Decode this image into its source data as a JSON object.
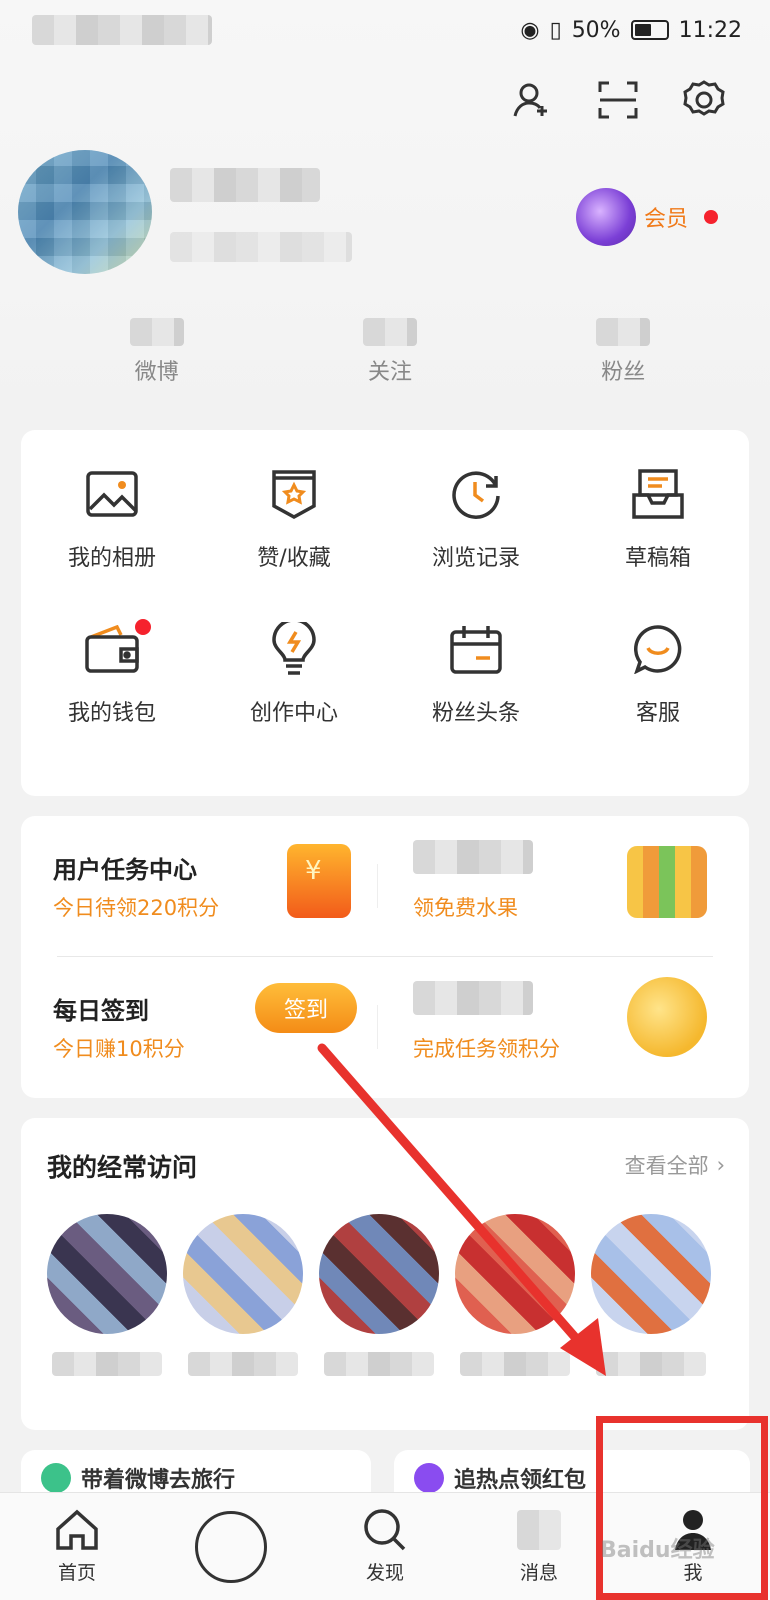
{
  "status_bar": {
    "battery": "50%",
    "time": "11:22"
  },
  "header": {
    "icons": [
      "add-friend-icon",
      "scan-icon",
      "settings-icon"
    ]
  },
  "profile": {
    "vip_label": "会员"
  },
  "stats": [
    {
      "label": "微博"
    },
    {
      "label": "关注"
    },
    {
      "label": "粉丝"
    }
  ],
  "grid": [
    {
      "label": "我的相册",
      "icon": "photo-album-icon"
    },
    {
      "label": "赞/收藏",
      "icon": "favorite-icon"
    },
    {
      "label": "浏览记录",
      "icon": "history-icon"
    },
    {
      "label": "草稿箱",
      "icon": "draft-box-icon"
    },
    {
      "label": "我的钱包",
      "icon": "wallet-icon"
    },
    {
      "label": "创作中心",
      "icon": "creator-center-icon"
    },
    {
      "label": "粉丝头条",
      "icon": "fans-headline-icon"
    },
    {
      "label": "客服",
      "icon": "customer-service-icon"
    }
  ],
  "tasks": {
    "task_center_title": "用户任务中心",
    "task_center_sub": "今日待领220积分",
    "fruit_sub": "领免费水果",
    "checkin_title": "每日签到",
    "checkin_sub": "今日赚10积分",
    "checkin_button": "签到",
    "points_sub": "完成任务领积分"
  },
  "frequent": {
    "title": "我的经常访问",
    "view_all": "查看全部"
  },
  "peek_cards": {
    "left": "带着微博去旅行",
    "right": "追热点领红包"
  },
  "bottom_nav": [
    {
      "label": "首页",
      "icon": "home-icon"
    },
    {
      "label": "",
      "icon": "publish-icon"
    },
    {
      "label": "发现",
      "icon": "discover-icon"
    },
    {
      "label": "消息",
      "icon": "message-icon"
    },
    {
      "label": "我",
      "icon": "profile-icon"
    }
  ],
  "watermark": "Baidu经验"
}
